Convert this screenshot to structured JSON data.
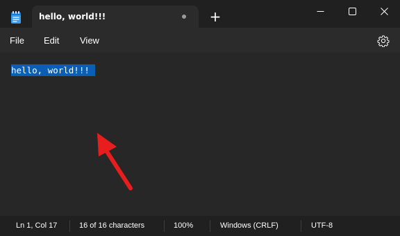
{
  "tab": {
    "title": "hello, world!!!",
    "new_tab_label": "+"
  },
  "menu": {
    "file": "File",
    "edit": "Edit",
    "view": "View"
  },
  "icons": {
    "app": "notepad-icon",
    "unsaved": "unsaved-dot-icon",
    "minimize": "minimize-icon",
    "maximize": "maximize-icon",
    "close": "close-icon",
    "settings": "gear-icon",
    "annotation": "red-arrow-icon"
  },
  "editor": {
    "content": "hello, world!!!",
    "selected": true
  },
  "status": {
    "position": "Ln 1, Col 17",
    "characters": "16 of 16 characters",
    "zoom": "100%",
    "line_ending": "Windows (CRLF)",
    "encoding": "UTF-8"
  },
  "colors": {
    "background": "#202020",
    "editor": "#272727",
    "selection": "#0a5fb4",
    "annotation": "#e81e1e"
  }
}
